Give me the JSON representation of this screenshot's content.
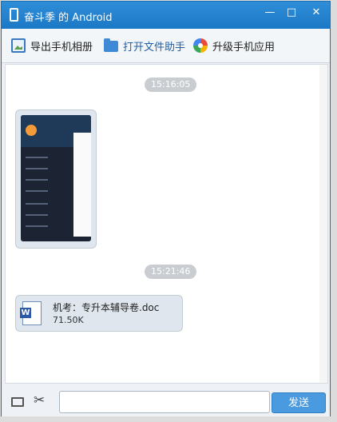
{
  "window": {
    "title": "奋斗季 的 Android",
    "minimize_label": "—",
    "maximize_label": "□",
    "close_label": "✕"
  },
  "toolbar": {
    "export_photos": "导出手机相册",
    "open_file_helper": "打开文件助手",
    "upgrade_apps": "升级手机应用"
  },
  "chat": {
    "messages": [
      {
        "time": "15:16:05",
        "type": "image"
      },
      {
        "time": "15:21:46",
        "type": "file",
        "file_name": "机考：专升本辅导卷.doc",
        "file_size": "71.50K"
      }
    ]
  },
  "composer": {
    "input_value": "",
    "send_label": "发送"
  },
  "colors": {
    "title_bar": "#1b78c6",
    "send_button": "#4a9ae0",
    "time_badge": "#c9cdd2"
  }
}
